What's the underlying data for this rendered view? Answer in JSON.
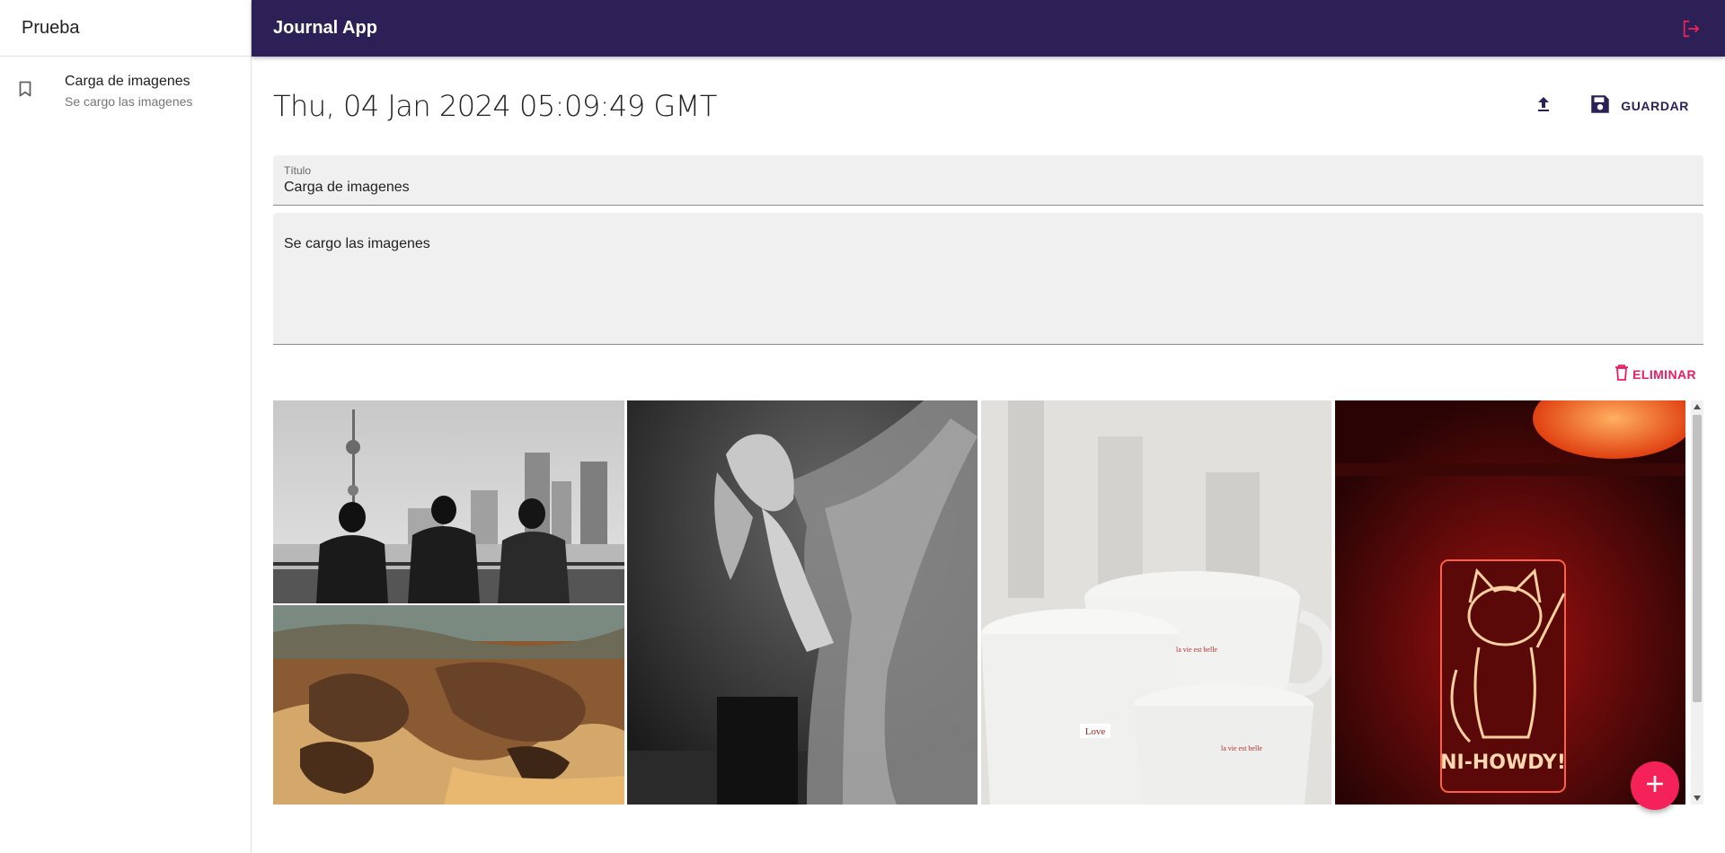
{
  "sidebar": {
    "title": "Prueba",
    "items": [
      {
        "title": "Carga de imagenes",
        "subtitle": "Se cargo las imagenes",
        "icon": "bookmark-icon"
      }
    ]
  },
  "appbar": {
    "title": "Journal App",
    "logout_icon": "logout-icon"
  },
  "note": {
    "date": "Thu, 04 Jan 2024 05:09:49 GMT",
    "upload_icon": "upload-icon",
    "save_icon": "save-icon",
    "save_label": "GUARDAR",
    "title_label": "Título",
    "title_value": "Carga de imagenes",
    "body_value": "Se cargo las imagenes",
    "delete_icon": "trash-icon",
    "delete_label": "ELIMINAR"
  },
  "gallery": {
    "images": [
      "city-skyline-men-photo",
      "desert-rocks-photo",
      "dancer-dress-photo",
      "white-cups-photo",
      "neon-cat-sign-photo"
    ]
  },
  "fab": {
    "icon": "add-icon"
  },
  "colors": {
    "appbar": "#2c2057",
    "accent": "#e91e63",
    "fab": "#f5225a"
  }
}
